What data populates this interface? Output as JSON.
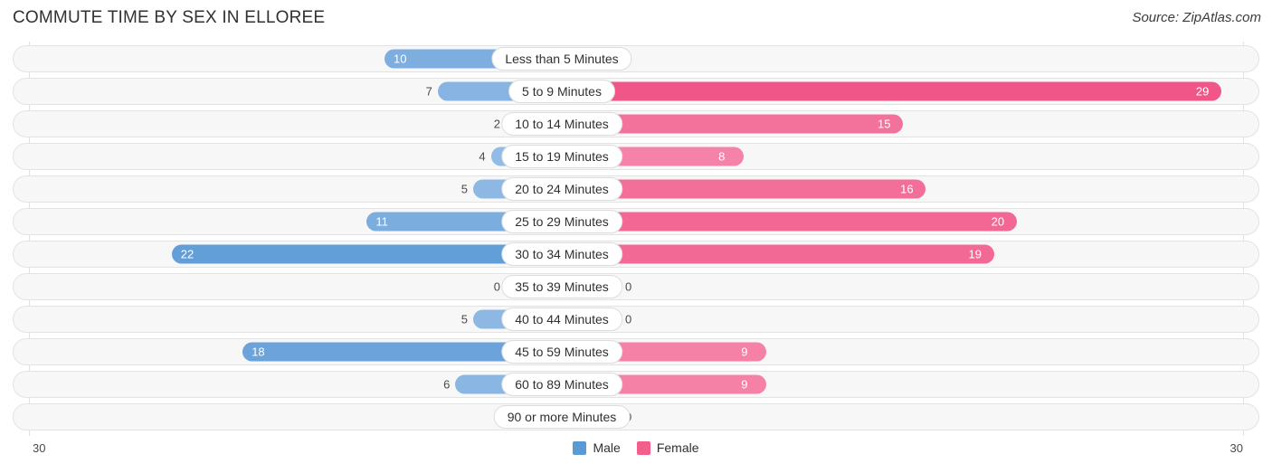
{
  "header": {
    "title": "COMMUTE TIME BY SEX IN ELLOREE",
    "source": "Source: ZipAtlas.com"
  },
  "axis": {
    "left_tick": "30",
    "right_tick": "30"
  },
  "legend": {
    "items": [
      {
        "label": "Male",
        "color": "#5b9bd5"
      },
      {
        "label": "Female",
        "color": "#f25f8a"
      }
    ]
  },
  "chart_data": {
    "type": "bar",
    "title": "COMMUTE TIME BY SEX IN ELLOREE",
    "subtitle": "Source: ZipAtlas.com",
    "orientation": "horizontal-diverging",
    "xlabel": "",
    "ylabel": "",
    "axis_max": 30,
    "xlim": [
      30,
      30
    ],
    "grid": false,
    "legend_position": "bottom-center",
    "categories": [
      "Less than 5 Minutes",
      "5 to 9 Minutes",
      "10 to 14 Minutes",
      "15 to 19 Minutes",
      "20 to 24 Minutes",
      "25 to 29 Minutes",
      "30 to 34 Minutes",
      "35 to 39 Minutes",
      "40 to 44 Minutes",
      "45 to 59 Minutes",
      "60 to 89 Minutes",
      "90 or more Minutes"
    ],
    "series": [
      {
        "name": "Male",
        "side": "left",
        "color": "#5b9bd5",
        "values": [
          10,
          7,
          2,
          4,
          5,
          11,
          22,
          0,
          5,
          18,
          6,
          0
        ]
      },
      {
        "name": "Female",
        "side": "right",
        "color": "#f25f8a",
        "values": [
          0,
          29,
          15,
          8,
          16,
          20,
          19,
          0,
          0,
          9,
          9,
          0
        ]
      }
    ]
  },
  "rows": [
    {
      "label": "Less than 5 Minutes",
      "male": "10",
      "female": "0"
    },
    {
      "label": "5 to 9 Minutes",
      "male": "7",
      "female": "29"
    },
    {
      "label": "10 to 14 Minutes",
      "male": "2",
      "female": "15"
    },
    {
      "label": "15 to 19 Minutes",
      "male": "4",
      "female": "8"
    },
    {
      "label": "20 to 24 Minutes",
      "male": "5",
      "female": "16"
    },
    {
      "label": "25 to 29 Minutes",
      "male": "11",
      "female": "20"
    },
    {
      "label": "30 to 34 Minutes",
      "male": "22",
      "female": "19"
    },
    {
      "label": "35 to 39 Minutes",
      "male": "0",
      "female": "0"
    },
    {
      "label": "40 to 44 Minutes",
      "male": "5",
      "female": "0"
    },
    {
      "label": "45 to 59 Minutes",
      "male": "18",
      "female": "9"
    },
    {
      "label": "60 to 89 Minutes",
      "male": "6",
      "female": "9"
    },
    {
      "label": "90 or more Minutes",
      "male": "0",
      "female": "0"
    }
  ]
}
